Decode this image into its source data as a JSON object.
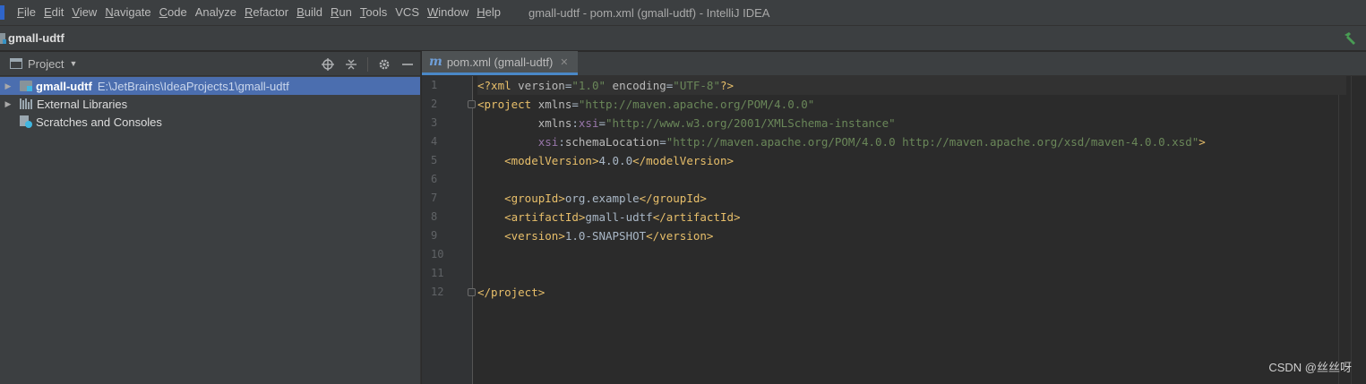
{
  "menubar": {
    "items": [
      {
        "mnemonic": "F",
        "rest": "ile"
      },
      {
        "mnemonic": "E",
        "rest": "dit"
      },
      {
        "mnemonic": "V",
        "rest": "iew"
      },
      {
        "mnemonic": "N",
        "rest": "avigate"
      },
      {
        "mnemonic": "C",
        "rest": "ode"
      },
      {
        "mnemonic": "",
        "rest": "Analyze"
      },
      {
        "mnemonic": "R",
        "rest": "efactor"
      },
      {
        "mnemonic": "B",
        "rest": "uild"
      },
      {
        "mnemonic": "R",
        "rest": "un"
      },
      {
        "mnemonic": "T",
        "rest": "ools"
      },
      {
        "mnemonic": "",
        "rest": "VCS"
      },
      {
        "mnemonic": "W",
        "rest": "indow"
      },
      {
        "mnemonic": "H",
        "rest": "elp"
      }
    ],
    "window_title": "gmall-udtf - pom.xml (gmall-udtf) - IntelliJ IDEA"
  },
  "navbar": {
    "crumb": "gmall-udtf"
  },
  "project_panel": {
    "title": "Project",
    "tree": [
      {
        "name": "gmall-udtf",
        "path": "E:\\JetBrains\\IdeaProjects1\\gmall-udtf",
        "expandable": true,
        "selected": true,
        "icon": "module-icon"
      },
      {
        "name": "External Libraries",
        "path": "",
        "expandable": true,
        "selected": false,
        "icon": "libraries-icon"
      },
      {
        "name": "Scratches and Consoles",
        "path": "",
        "expandable": false,
        "selected": false,
        "icon": "scratches-icon"
      }
    ]
  },
  "editor": {
    "tab": {
      "icon": "m",
      "label": "pom.xml (gmall-udtf)"
    },
    "line_numbers": [
      "1",
      "2",
      "3",
      "4",
      "5",
      "6",
      "7",
      "8",
      "9",
      "10",
      "11",
      "12"
    ],
    "lines": [
      [
        {
          "t": "tag",
          "v": "<?xml "
        },
        {
          "t": "attr",
          "v": "version"
        },
        {
          "t": "text",
          "v": "="
        },
        {
          "t": "val",
          "v": "\"1.0\""
        },
        {
          "t": "text",
          "v": " "
        },
        {
          "t": "attr",
          "v": "encoding"
        },
        {
          "t": "text",
          "v": "="
        },
        {
          "t": "val",
          "v": "\"UTF-8\""
        },
        {
          "t": "tag",
          "v": "?>"
        }
      ],
      [
        {
          "t": "tag",
          "v": "<project "
        },
        {
          "t": "attr",
          "v": "xmlns"
        },
        {
          "t": "text",
          "v": "="
        },
        {
          "t": "val",
          "v": "\"http://maven.apache.org/POM/4.0.0\""
        }
      ],
      [
        {
          "t": "text",
          "v": "         "
        },
        {
          "t": "attr",
          "v": "xmlns"
        },
        {
          "t": "text",
          "v": ":"
        },
        {
          "t": "ns",
          "v": "xsi"
        },
        {
          "t": "text",
          "v": "="
        },
        {
          "t": "val",
          "v": "\"http://www.w3.org/2001/XMLSchema-instance\""
        }
      ],
      [
        {
          "t": "text",
          "v": "         "
        },
        {
          "t": "ns",
          "v": "xsi"
        },
        {
          "t": "text",
          "v": ":"
        },
        {
          "t": "attr",
          "v": "schemaLocation"
        },
        {
          "t": "text",
          "v": "="
        },
        {
          "t": "val",
          "v": "\"http://maven.apache.org/POM/4.0.0 http://maven.apache.org/xsd/maven-4.0.0.xsd\""
        },
        {
          "t": "tag",
          "v": ">"
        }
      ],
      [
        {
          "t": "text",
          "v": "    "
        },
        {
          "t": "tag",
          "v": "<modelVersion>"
        },
        {
          "t": "text",
          "v": "4.0.0"
        },
        {
          "t": "tag",
          "v": "</modelVersion>"
        }
      ],
      [],
      [
        {
          "t": "text",
          "v": "    "
        },
        {
          "t": "tag",
          "v": "<groupId>"
        },
        {
          "t": "text",
          "v": "org.example"
        },
        {
          "t": "tag",
          "v": "</groupId>"
        }
      ],
      [
        {
          "t": "text",
          "v": "    "
        },
        {
          "t": "tag",
          "v": "<artifactId>"
        },
        {
          "t": "text",
          "v": "gmall-udtf"
        },
        {
          "t": "tag",
          "v": "</artifactId>"
        }
      ],
      [
        {
          "t": "text",
          "v": "    "
        },
        {
          "t": "tag",
          "v": "<version>"
        },
        {
          "t": "text",
          "v": "1.0-SNAPSHOT"
        },
        {
          "t": "tag",
          "v": "</version>"
        }
      ],
      [],
      [],
      [
        {
          "t": "tag",
          "v": "</project>"
        }
      ]
    ],
    "fold_markers": [
      1,
      11
    ]
  },
  "watermark": "CSDN @丝丝呀",
  "colors": {
    "selection": "#4b6eaf",
    "tag": "#e8bf6a",
    "string": "#6a8759",
    "namespace": "#9876aa",
    "build_icon": "#499c54"
  }
}
